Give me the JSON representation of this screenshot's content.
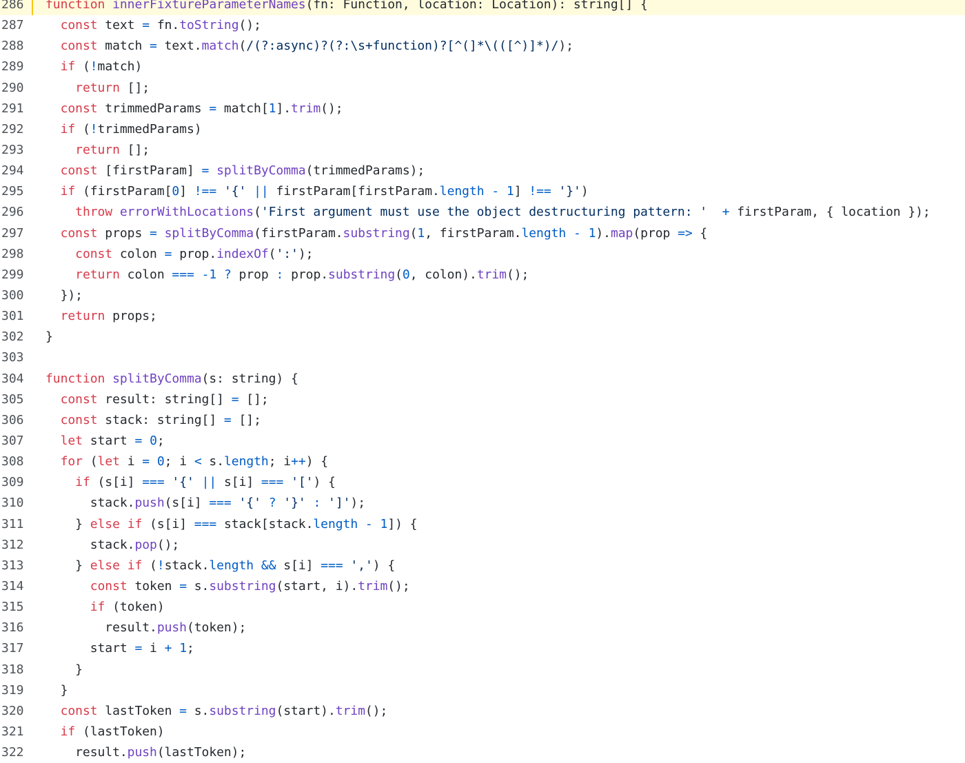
{
  "highlighted_line": 286,
  "colors": {
    "keyword": "#d73a49",
    "function": "#6f42c1",
    "string": "#032f62",
    "number": "#005cc5",
    "operator": "#005cc5",
    "plain": "#24292e",
    "highlight_bg": "#fffbdd",
    "highlight_border": "#f9c513"
  },
  "lines": [
    {
      "number": "286",
      "tokens": [
        [
          "kw",
          "function"
        ],
        [
          "plain",
          " "
        ],
        [
          "fn",
          "innerFixtureParameterNames"
        ],
        [
          "plain",
          "(fn: Function, location: Location): string[] {"
        ]
      ]
    },
    {
      "number": "287",
      "tokens": [
        [
          "plain",
          "  "
        ],
        [
          "kw",
          "const"
        ],
        [
          "plain",
          " text "
        ],
        [
          "op",
          "="
        ],
        [
          "plain",
          " fn."
        ],
        [
          "fn",
          "toString"
        ],
        [
          "plain",
          "();"
        ]
      ]
    },
    {
      "number": "288",
      "tokens": [
        [
          "plain",
          "  "
        ],
        [
          "kw",
          "const"
        ],
        [
          "plain",
          " match "
        ],
        [
          "op",
          "="
        ],
        [
          "plain",
          " text."
        ],
        [
          "fn",
          "match"
        ],
        [
          "plain",
          "("
        ],
        [
          "rx",
          "/(?:async)?(?:\\s+function)?[^(]*\\(([^)]*)/"
        ],
        [
          "plain",
          ");"
        ]
      ]
    },
    {
      "number": "289",
      "tokens": [
        [
          "plain",
          "  "
        ],
        [
          "kw",
          "if"
        ],
        [
          "plain",
          " ("
        ],
        [
          "op",
          "!"
        ],
        [
          "plain",
          "match)"
        ]
      ]
    },
    {
      "number": "290",
      "tokens": [
        [
          "plain",
          "    "
        ],
        [
          "kw",
          "return"
        ],
        [
          "plain",
          " [];"
        ]
      ]
    },
    {
      "number": "291",
      "tokens": [
        [
          "plain",
          "  "
        ],
        [
          "kw",
          "const"
        ],
        [
          "plain",
          " trimmedParams "
        ],
        [
          "op",
          "="
        ],
        [
          "plain",
          " match["
        ],
        [
          "num",
          "1"
        ],
        [
          "plain",
          "]."
        ],
        [
          "fn",
          "trim"
        ],
        [
          "plain",
          "();"
        ]
      ]
    },
    {
      "number": "292",
      "tokens": [
        [
          "plain",
          "  "
        ],
        [
          "kw",
          "if"
        ],
        [
          "plain",
          " ("
        ],
        [
          "op",
          "!"
        ],
        [
          "plain",
          "trimmedParams)"
        ]
      ]
    },
    {
      "number": "293",
      "tokens": [
        [
          "plain",
          "    "
        ],
        [
          "kw",
          "return"
        ],
        [
          "plain",
          " [];"
        ]
      ]
    },
    {
      "number": "294",
      "tokens": [
        [
          "plain",
          "  "
        ],
        [
          "kw",
          "const"
        ],
        [
          "plain",
          " [firstParam] "
        ],
        [
          "op",
          "="
        ],
        [
          "plain",
          " "
        ],
        [
          "fn",
          "splitByComma"
        ],
        [
          "plain",
          "(trimmedParams);"
        ]
      ]
    },
    {
      "number": "295",
      "tokens": [
        [
          "plain",
          "  "
        ],
        [
          "kw",
          "if"
        ],
        [
          "plain",
          " (firstParam["
        ],
        [
          "num",
          "0"
        ],
        [
          "plain",
          "] "
        ],
        [
          "op",
          "!=="
        ],
        [
          "plain",
          " "
        ],
        [
          "str",
          "'{'"
        ],
        [
          "plain",
          " "
        ],
        [
          "op",
          "||"
        ],
        [
          "plain",
          " firstParam[firstParam."
        ],
        [
          "prop",
          "length"
        ],
        [
          "plain",
          " "
        ],
        [
          "op",
          "-"
        ],
        [
          "plain",
          " "
        ],
        [
          "num",
          "1"
        ],
        [
          "plain",
          "] "
        ],
        [
          "op",
          "!=="
        ],
        [
          "plain",
          " "
        ],
        [
          "str",
          "'}'"
        ],
        [
          "plain",
          ")"
        ]
      ]
    },
    {
      "number": "296",
      "tokens": [
        [
          "plain",
          "    "
        ],
        [
          "kw",
          "throw"
        ],
        [
          "plain",
          " "
        ],
        [
          "fn",
          "errorWithLocations"
        ],
        [
          "plain",
          "("
        ],
        [
          "str",
          "'First argument must use the object destructuring pattern: '"
        ],
        [
          "plain",
          "  "
        ],
        [
          "op",
          "+"
        ],
        [
          "plain",
          " firstParam, { location });"
        ]
      ]
    },
    {
      "number": "297",
      "tokens": [
        [
          "plain",
          "  "
        ],
        [
          "kw",
          "const"
        ],
        [
          "plain",
          " props "
        ],
        [
          "op",
          "="
        ],
        [
          "plain",
          " "
        ],
        [
          "fn",
          "splitByComma"
        ],
        [
          "plain",
          "(firstParam."
        ],
        [
          "fn",
          "substring"
        ],
        [
          "plain",
          "("
        ],
        [
          "num",
          "1"
        ],
        [
          "plain",
          ", firstParam."
        ],
        [
          "prop",
          "length"
        ],
        [
          "plain",
          " "
        ],
        [
          "op",
          "-"
        ],
        [
          "plain",
          " "
        ],
        [
          "num",
          "1"
        ],
        [
          "plain",
          ")."
        ],
        [
          "fn",
          "map"
        ],
        [
          "plain",
          "(prop "
        ],
        [
          "op",
          "=>"
        ],
        [
          "plain",
          " {"
        ]
      ]
    },
    {
      "number": "298",
      "tokens": [
        [
          "plain",
          "    "
        ],
        [
          "kw",
          "const"
        ],
        [
          "plain",
          " colon "
        ],
        [
          "op",
          "="
        ],
        [
          "plain",
          " prop."
        ],
        [
          "fn",
          "indexOf"
        ],
        [
          "plain",
          "("
        ],
        [
          "str",
          "':'"
        ],
        [
          "plain",
          ");"
        ]
      ]
    },
    {
      "number": "299",
      "tokens": [
        [
          "plain",
          "    "
        ],
        [
          "kw",
          "return"
        ],
        [
          "plain",
          " colon "
        ],
        [
          "op",
          "==="
        ],
        [
          "plain",
          " "
        ],
        [
          "op",
          "-"
        ],
        [
          "num",
          "1"
        ],
        [
          "plain",
          " "
        ],
        [
          "op",
          "?"
        ],
        [
          "plain",
          " prop "
        ],
        [
          "op",
          ":"
        ],
        [
          "plain",
          " prop."
        ],
        [
          "fn",
          "substring"
        ],
        [
          "plain",
          "("
        ],
        [
          "num",
          "0"
        ],
        [
          "plain",
          ", colon)."
        ],
        [
          "fn",
          "trim"
        ],
        [
          "plain",
          "();"
        ]
      ]
    },
    {
      "number": "300",
      "tokens": [
        [
          "plain",
          "  });"
        ]
      ]
    },
    {
      "number": "301",
      "tokens": [
        [
          "plain",
          "  "
        ],
        [
          "kw",
          "return"
        ],
        [
          "plain",
          " props;"
        ]
      ]
    },
    {
      "number": "302",
      "tokens": [
        [
          "plain",
          "}"
        ]
      ]
    },
    {
      "number": "303",
      "tokens": [
        [
          "plain",
          ""
        ]
      ]
    },
    {
      "number": "304",
      "tokens": [
        [
          "kw",
          "function"
        ],
        [
          "plain",
          " "
        ],
        [
          "fn",
          "splitByComma"
        ],
        [
          "plain",
          "(s: string) {"
        ]
      ]
    },
    {
      "number": "305",
      "tokens": [
        [
          "plain",
          "  "
        ],
        [
          "kw",
          "const"
        ],
        [
          "plain",
          " result: string[] "
        ],
        [
          "op",
          "="
        ],
        [
          "plain",
          " [];"
        ]
      ]
    },
    {
      "number": "306",
      "tokens": [
        [
          "plain",
          "  "
        ],
        [
          "kw",
          "const"
        ],
        [
          "plain",
          " stack: string[] "
        ],
        [
          "op",
          "="
        ],
        [
          "plain",
          " [];"
        ]
      ]
    },
    {
      "number": "307",
      "tokens": [
        [
          "plain",
          "  "
        ],
        [
          "kw",
          "let"
        ],
        [
          "plain",
          " start "
        ],
        [
          "op",
          "="
        ],
        [
          "plain",
          " "
        ],
        [
          "num",
          "0"
        ],
        [
          "plain",
          ";"
        ]
      ]
    },
    {
      "number": "308",
      "tokens": [
        [
          "plain",
          "  "
        ],
        [
          "kw",
          "for"
        ],
        [
          "plain",
          " ("
        ],
        [
          "kw",
          "let"
        ],
        [
          "plain",
          " i "
        ],
        [
          "op",
          "="
        ],
        [
          "plain",
          " "
        ],
        [
          "num",
          "0"
        ],
        [
          "plain",
          "; i "
        ],
        [
          "op",
          "<"
        ],
        [
          "plain",
          " s."
        ],
        [
          "prop",
          "length"
        ],
        [
          "plain",
          "; i"
        ],
        [
          "op",
          "++"
        ],
        [
          "plain",
          ") {"
        ]
      ]
    },
    {
      "number": "309",
      "tokens": [
        [
          "plain",
          "    "
        ],
        [
          "kw",
          "if"
        ],
        [
          "plain",
          " (s[i] "
        ],
        [
          "op",
          "==="
        ],
        [
          "plain",
          " "
        ],
        [
          "str",
          "'{'"
        ],
        [
          "plain",
          " "
        ],
        [
          "op",
          "||"
        ],
        [
          "plain",
          " s[i] "
        ],
        [
          "op",
          "==="
        ],
        [
          "plain",
          " "
        ],
        [
          "str",
          "'['"
        ],
        [
          "plain",
          ") {"
        ]
      ]
    },
    {
      "number": "310",
      "tokens": [
        [
          "plain",
          "      stack."
        ],
        [
          "fn",
          "push"
        ],
        [
          "plain",
          "(s[i] "
        ],
        [
          "op",
          "==="
        ],
        [
          "plain",
          " "
        ],
        [
          "str",
          "'{'"
        ],
        [
          "plain",
          " "
        ],
        [
          "op",
          "?"
        ],
        [
          "plain",
          " "
        ],
        [
          "str",
          "'}'"
        ],
        [
          "plain",
          " "
        ],
        [
          "op",
          ":"
        ],
        [
          "plain",
          " "
        ],
        [
          "str",
          "']'"
        ],
        [
          "plain",
          ");"
        ]
      ]
    },
    {
      "number": "311",
      "tokens": [
        [
          "plain",
          "    } "
        ],
        [
          "kw",
          "else"
        ],
        [
          "plain",
          " "
        ],
        [
          "kw",
          "if"
        ],
        [
          "plain",
          " (s[i] "
        ],
        [
          "op",
          "==="
        ],
        [
          "plain",
          " stack[stack."
        ],
        [
          "prop",
          "length"
        ],
        [
          "plain",
          " "
        ],
        [
          "op",
          "-"
        ],
        [
          "plain",
          " "
        ],
        [
          "num",
          "1"
        ],
        [
          "plain",
          "]) {"
        ]
      ]
    },
    {
      "number": "312",
      "tokens": [
        [
          "plain",
          "      stack."
        ],
        [
          "fn",
          "pop"
        ],
        [
          "plain",
          "();"
        ]
      ]
    },
    {
      "number": "313",
      "tokens": [
        [
          "plain",
          "    } "
        ],
        [
          "kw",
          "else"
        ],
        [
          "plain",
          " "
        ],
        [
          "kw",
          "if"
        ],
        [
          "plain",
          " ("
        ],
        [
          "op",
          "!"
        ],
        [
          "plain",
          "stack."
        ],
        [
          "prop",
          "length"
        ],
        [
          "plain",
          " "
        ],
        [
          "op",
          "&&"
        ],
        [
          "plain",
          " s[i] "
        ],
        [
          "op",
          "==="
        ],
        [
          "plain",
          " "
        ],
        [
          "str",
          "','"
        ],
        [
          "plain",
          ") {"
        ]
      ]
    },
    {
      "number": "314",
      "tokens": [
        [
          "plain",
          "      "
        ],
        [
          "kw",
          "const"
        ],
        [
          "plain",
          " token "
        ],
        [
          "op",
          "="
        ],
        [
          "plain",
          " s."
        ],
        [
          "fn",
          "substring"
        ],
        [
          "plain",
          "(start, i)."
        ],
        [
          "fn",
          "trim"
        ],
        [
          "plain",
          "();"
        ]
      ]
    },
    {
      "number": "315",
      "tokens": [
        [
          "plain",
          "      "
        ],
        [
          "kw",
          "if"
        ],
        [
          "plain",
          " (token)"
        ]
      ]
    },
    {
      "number": "316",
      "tokens": [
        [
          "plain",
          "        result."
        ],
        [
          "fn",
          "push"
        ],
        [
          "plain",
          "(token);"
        ]
      ]
    },
    {
      "number": "317",
      "tokens": [
        [
          "plain",
          "      start "
        ],
        [
          "op",
          "="
        ],
        [
          "plain",
          " i "
        ],
        [
          "op",
          "+"
        ],
        [
          "plain",
          " "
        ],
        [
          "num",
          "1"
        ],
        [
          "plain",
          ";"
        ]
      ]
    },
    {
      "number": "318",
      "tokens": [
        [
          "plain",
          "    }"
        ]
      ]
    },
    {
      "number": "319",
      "tokens": [
        [
          "plain",
          "  }"
        ]
      ]
    },
    {
      "number": "320",
      "tokens": [
        [
          "plain",
          "  "
        ],
        [
          "kw",
          "const"
        ],
        [
          "plain",
          " lastToken "
        ],
        [
          "op",
          "="
        ],
        [
          "plain",
          " s."
        ],
        [
          "fn",
          "substring"
        ],
        [
          "plain",
          "(start)."
        ],
        [
          "fn",
          "trim"
        ],
        [
          "plain",
          "();"
        ]
      ]
    },
    {
      "number": "321",
      "tokens": [
        [
          "plain",
          "  "
        ],
        [
          "kw",
          "if"
        ],
        [
          "plain",
          " (lastToken)"
        ]
      ]
    },
    {
      "number": "322",
      "tokens": [
        [
          "plain",
          "    result."
        ],
        [
          "fn",
          "push"
        ],
        [
          "plain",
          "(lastToken);"
        ]
      ]
    }
  ]
}
